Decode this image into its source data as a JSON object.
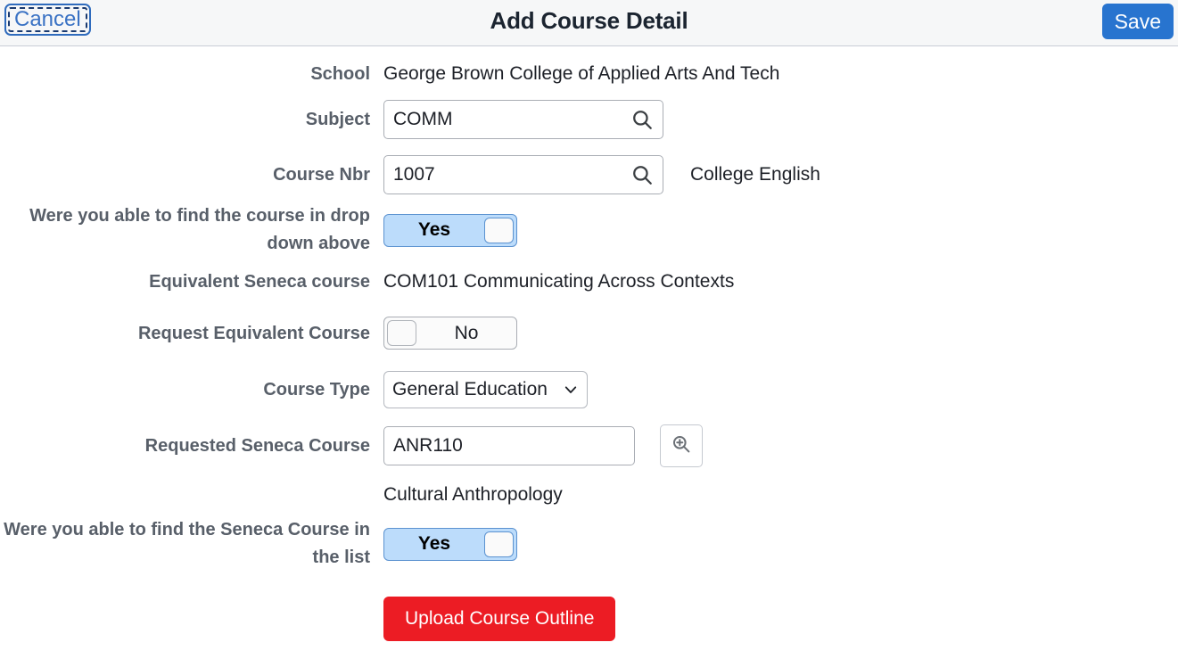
{
  "header": {
    "cancel_label": "Cancel",
    "title": "Add Course Detail",
    "save_label": "Save",
    "accent_blue": "#2874cf",
    "background": "#f6f7f8"
  },
  "form": {
    "school": {
      "label": "School",
      "value": "George Brown College of Applied Arts And Tech"
    },
    "subject": {
      "label": "Subject",
      "value": "COMM",
      "placeholder": ""
    },
    "course_nbr": {
      "label": "Course Nbr",
      "value": "1007",
      "placeholder": "",
      "description": "College English"
    },
    "find_course": {
      "label": "Were you able to find the course in drop down above",
      "value": "Yes",
      "state": "on"
    },
    "equivalent_seneca_course": {
      "label": "Equivalent Seneca course",
      "value": "COM101 Communicating Across Contexts"
    },
    "request_equivalent_course": {
      "label": "Request Equivalent Course",
      "value": "No",
      "state": "off"
    },
    "course_type": {
      "label": "Course Type",
      "value": "General Education",
      "options": [
        "General Education"
      ]
    },
    "requested_seneca_course": {
      "label": "Requested Seneca Course",
      "value": "ANR110",
      "placeholder": "",
      "description": "Cultural Anthropology"
    },
    "find_seneca_course": {
      "label": "Were you able to find the Seneca Course in the list",
      "value": "Yes",
      "state": "on"
    },
    "upload": {
      "label": "Upload Course Outline",
      "color": "#ec1c24"
    }
  },
  "icons": {
    "search": "search-icon",
    "zoom_in": "zoom-in-icon",
    "chevron_down": "chevron-down-icon"
  }
}
